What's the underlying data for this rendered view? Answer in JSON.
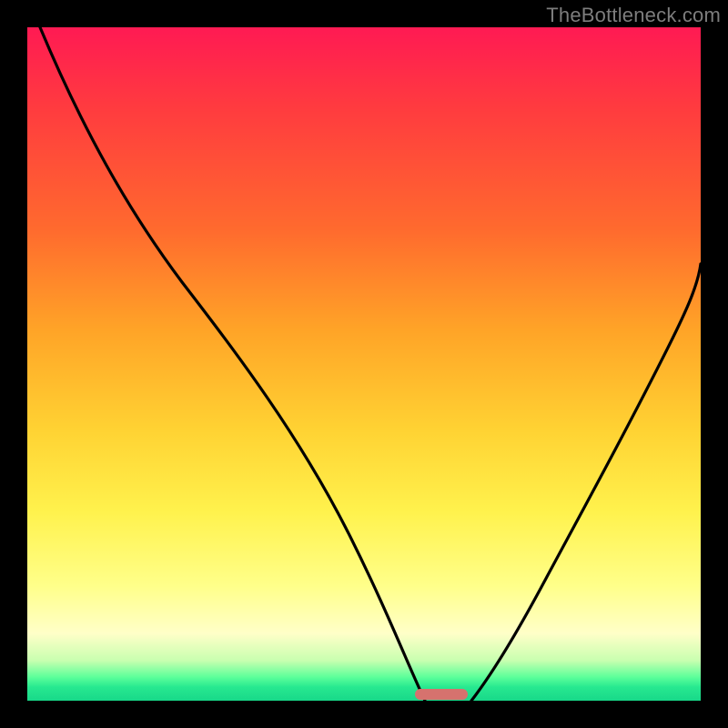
{
  "watermark": "TheBottleneck.com",
  "colors": {
    "curve_stroke": "#000000",
    "marker_fill": "#d6726e"
  },
  "chart_data": {
    "type": "line",
    "title": "",
    "xlabel": "",
    "ylabel": "",
    "xlim": [
      0,
      100
    ],
    "ylim": [
      0,
      100
    ],
    "grid": false,
    "legend": false,
    "series": [
      {
        "name": "left-branch",
        "x": [
          2,
          7,
          13,
          20,
          27,
          34,
          40,
          46,
          51,
          54.5,
          57.5,
          59
        ],
        "y": [
          100,
          88,
          77,
          68,
          60,
          51,
          42,
          31,
          19,
          9,
          2,
          0
        ]
      },
      {
        "name": "right-branch",
        "x": [
          66,
          69,
          73,
          78,
          83,
          88,
          93,
          98,
          100
        ],
        "y": [
          0,
          3,
          9,
          18,
          28,
          39,
          50,
          61,
          65
        ]
      }
    ],
    "annotations": [
      {
        "name": "minimum-marker",
        "x_range": [
          57.5,
          65.5
        ],
        "y": 0
      }
    ]
  }
}
